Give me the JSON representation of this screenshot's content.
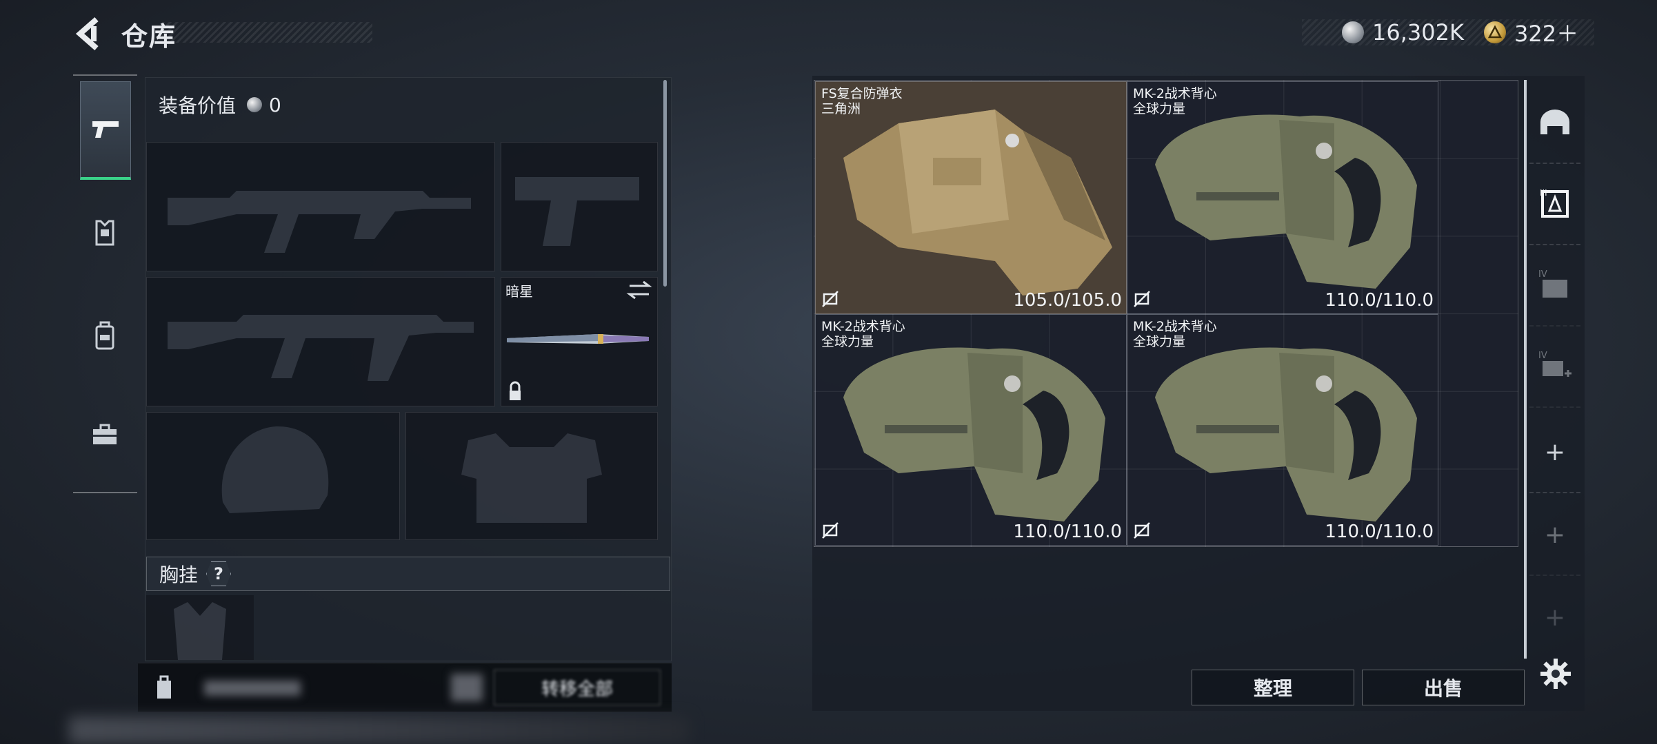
{
  "header": {
    "title": "仓库",
    "currencies": [
      {
        "icon": "silver-coin-icon",
        "value": "16,302K"
      },
      {
        "icon": "gold-triangle-coin-icon",
        "value": "322＋"
      }
    ]
  },
  "categories": [
    {
      "icon": "pistol-icon",
      "active": true
    },
    {
      "icon": "armor-rig-icon",
      "active": false
    },
    {
      "icon": "backpack-icon",
      "active": false
    },
    {
      "icon": "toolbox-icon",
      "active": false
    }
  ],
  "loadout": {
    "value_label": "装备价值",
    "value": "0",
    "melee_name": "暗星",
    "chest_label": "胸挂",
    "chest_help": "?",
    "bottom_button": "转移全部",
    "colors": {
      "accent": "#3ad38a"
    }
  },
  "stash": {
    "items": [
      {
        "name_line1": "FS复合防弹衣",
        "name_line2": "三角洲",
        "durability": "105.0/105.0",
        "color": "#a58e62"
      },
      {
        "name_line1": "MK-2战术背心",
        "name_line2": "全球力量",
        "durability": "110.0/110.0",
        "color": "#7b8064"
      },
      {
        "name_line1": "MK-2战术背心",
        "name_line2": "全球力量",
        "durability": "110.0/110.0",
        "color": "#7b8064"
      },
      {
        "name_line1": "MK-2战术背心",
        "name_line2": "全球力量",
        "durability": "110.0/110.0",
        "color": "#7b8064"
      }
    ]
  },
  "side_tabs": [
    {
      "icon": "helmet-icon"
    },
    {
      "icon": "armor-filter-icon"
    },
    {
      "icon": "level-four-case-icon"
    },
    {
      "icon": "level-four-add-icon"
    },
    {
      "icon": "plus-icon",
      "label": "+"
    },
    {
      "icon": "plus-icon",
      "label": "+"
    },
    {
      "icon": "plus-icon",
      "label": "+"
    }
  ],
  "actions": {
    "organize": "整理",
    "sell": "出售"
  }
}
